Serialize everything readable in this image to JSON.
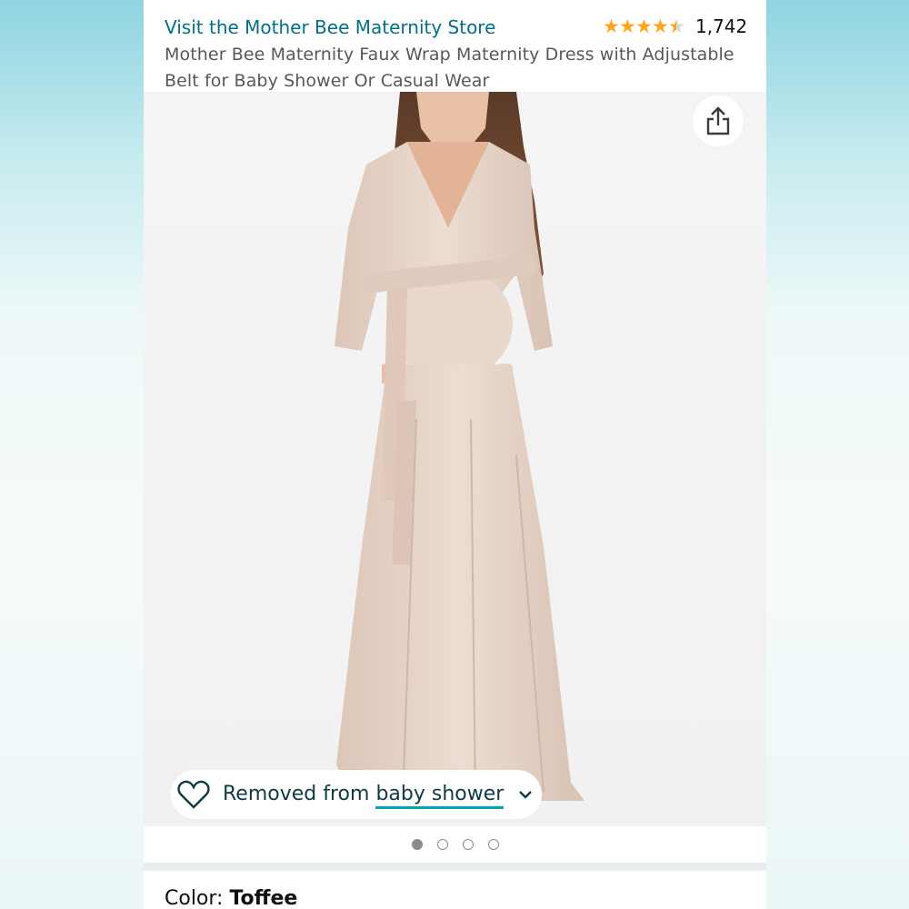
{
  "store": {
    "link_text": "Visit the Mother Bee Maternity Store"
  },
  "rating": {
    "stars": 4.5,
    "count": "1,742"
  },
  "product": {
    "title": "Mother Bee Maternity Faux Wrap Maternity Dress with Adjustable Belt for Baby Shower Or Casual Wear",
    "image_icon": "share-icon"
  },
  "wishlist": {
    "prefix": "Removed from",
    "list_name": "baby shower",
    "icon": "heart-outline-icon"
  },
  "carousel": {
    "total": 4,
    "active": 1
  },
  "color": {
    "label": "Color:",
    "value": "Toffee"
  },
  "colors": {
    "link": "#007185",
    "star": "#ffa41c",
    "dress": "#e8d6cb"
  }
}
